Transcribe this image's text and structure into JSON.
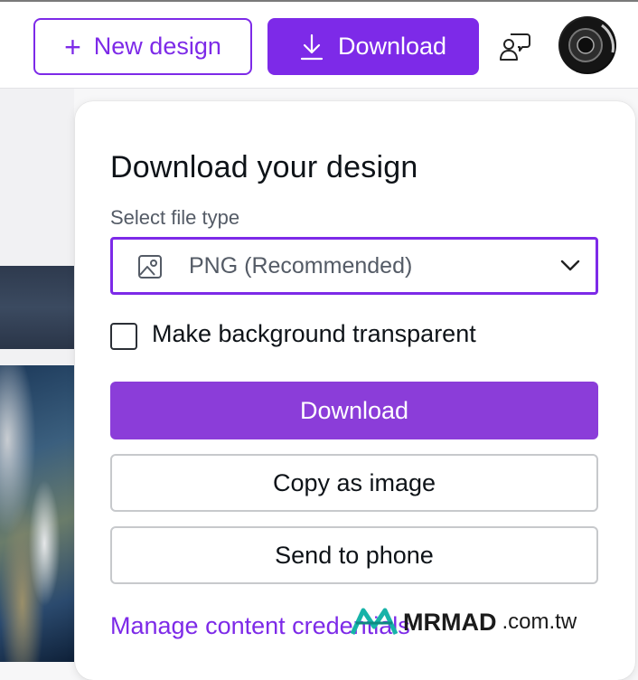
{
  "header": {
    "new_design_label": "New design",
    "download_label": "Download",
    "comments_icon": "comments-icon",
    "avatar_icon": "user-avatar"
  },
  "panel": {
    "title": "Download your design",
    "file_type_label": "Select file type",
    "file_type_value": "PNG (Recommended)",
    "file_type_icon": "image-icon",
    "transparent_label": "Make background transparent",
    "transparent_checked": false,
    "download_button": "Download",
    "copy_button": "Copy as image",
    "phone_button": "Send to phone",
    "credentials_link": "Manage content credentials"
  },
  "watermark": {
    "brand": "MRMAD",
    "suffix": ".com.tw"
  },
  "colors": {
    "accent": "#7d2ae8",
    "primary_button": "#8b3dd9",
    "text": "#0e1318",
    "muted_text": "#545b66"
  }
}
